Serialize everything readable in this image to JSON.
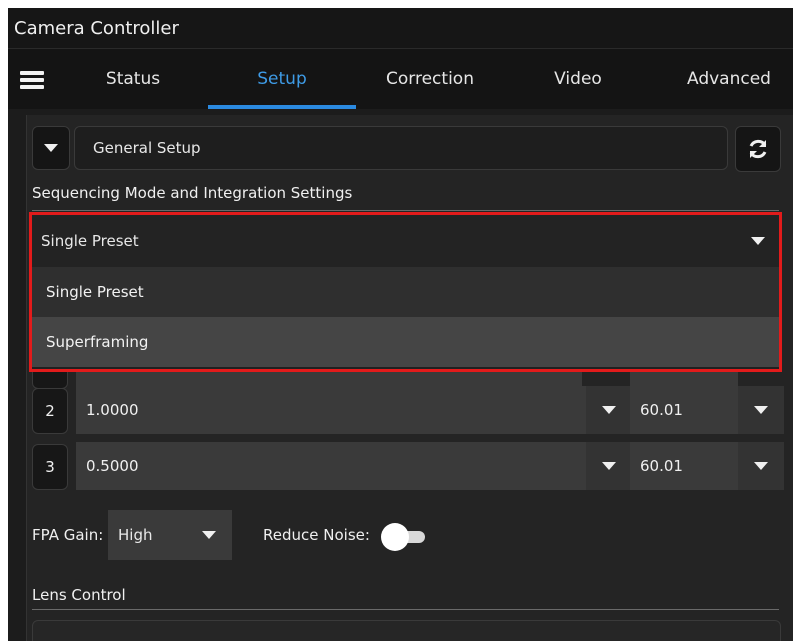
{
  "window": {
    "title": "Camera Controller"
  },
  "tabs": [
    {
      "label": "Status"
    },
    {
      "label": "Setup",
      "active": true
    },
    {
      "label": "Correction"
    },
    {
      "label": "Video"
    },
    {
      "label": "Advanced"
    }
  ],
  "section_select": {
    "value": "General Setup"
  },
  "refresh": {
    "icon": "refresh-icon"
  },
  "sequencing": {
    "heading": "Sequencing Mode and Integration Settings",
    "selected": "Single Preset",
    "options": [
      "Single Preset",
      "Superframing"
    ]
  },
  "presets": [
    {
      "num": "2",
      "integration": "1.0000",
      "rate": "60.01"
    },
    {
      "num": "3",
      "integration": "0.5000",
      "rate": "60.01"
    }
  ],
  "fpa_gain": {
    "label": "FPA Gain:",
    "value": "High"
  },
  "reduce_noise": {
    "label": "Reduce Noise:",
    "on": false
  },
  "lens": {
    "heading": "Lens Control"
  },
  "colors": {
    "accent": "#2b8ae0",
    "highlight": "#e21b1b"
  }
}
